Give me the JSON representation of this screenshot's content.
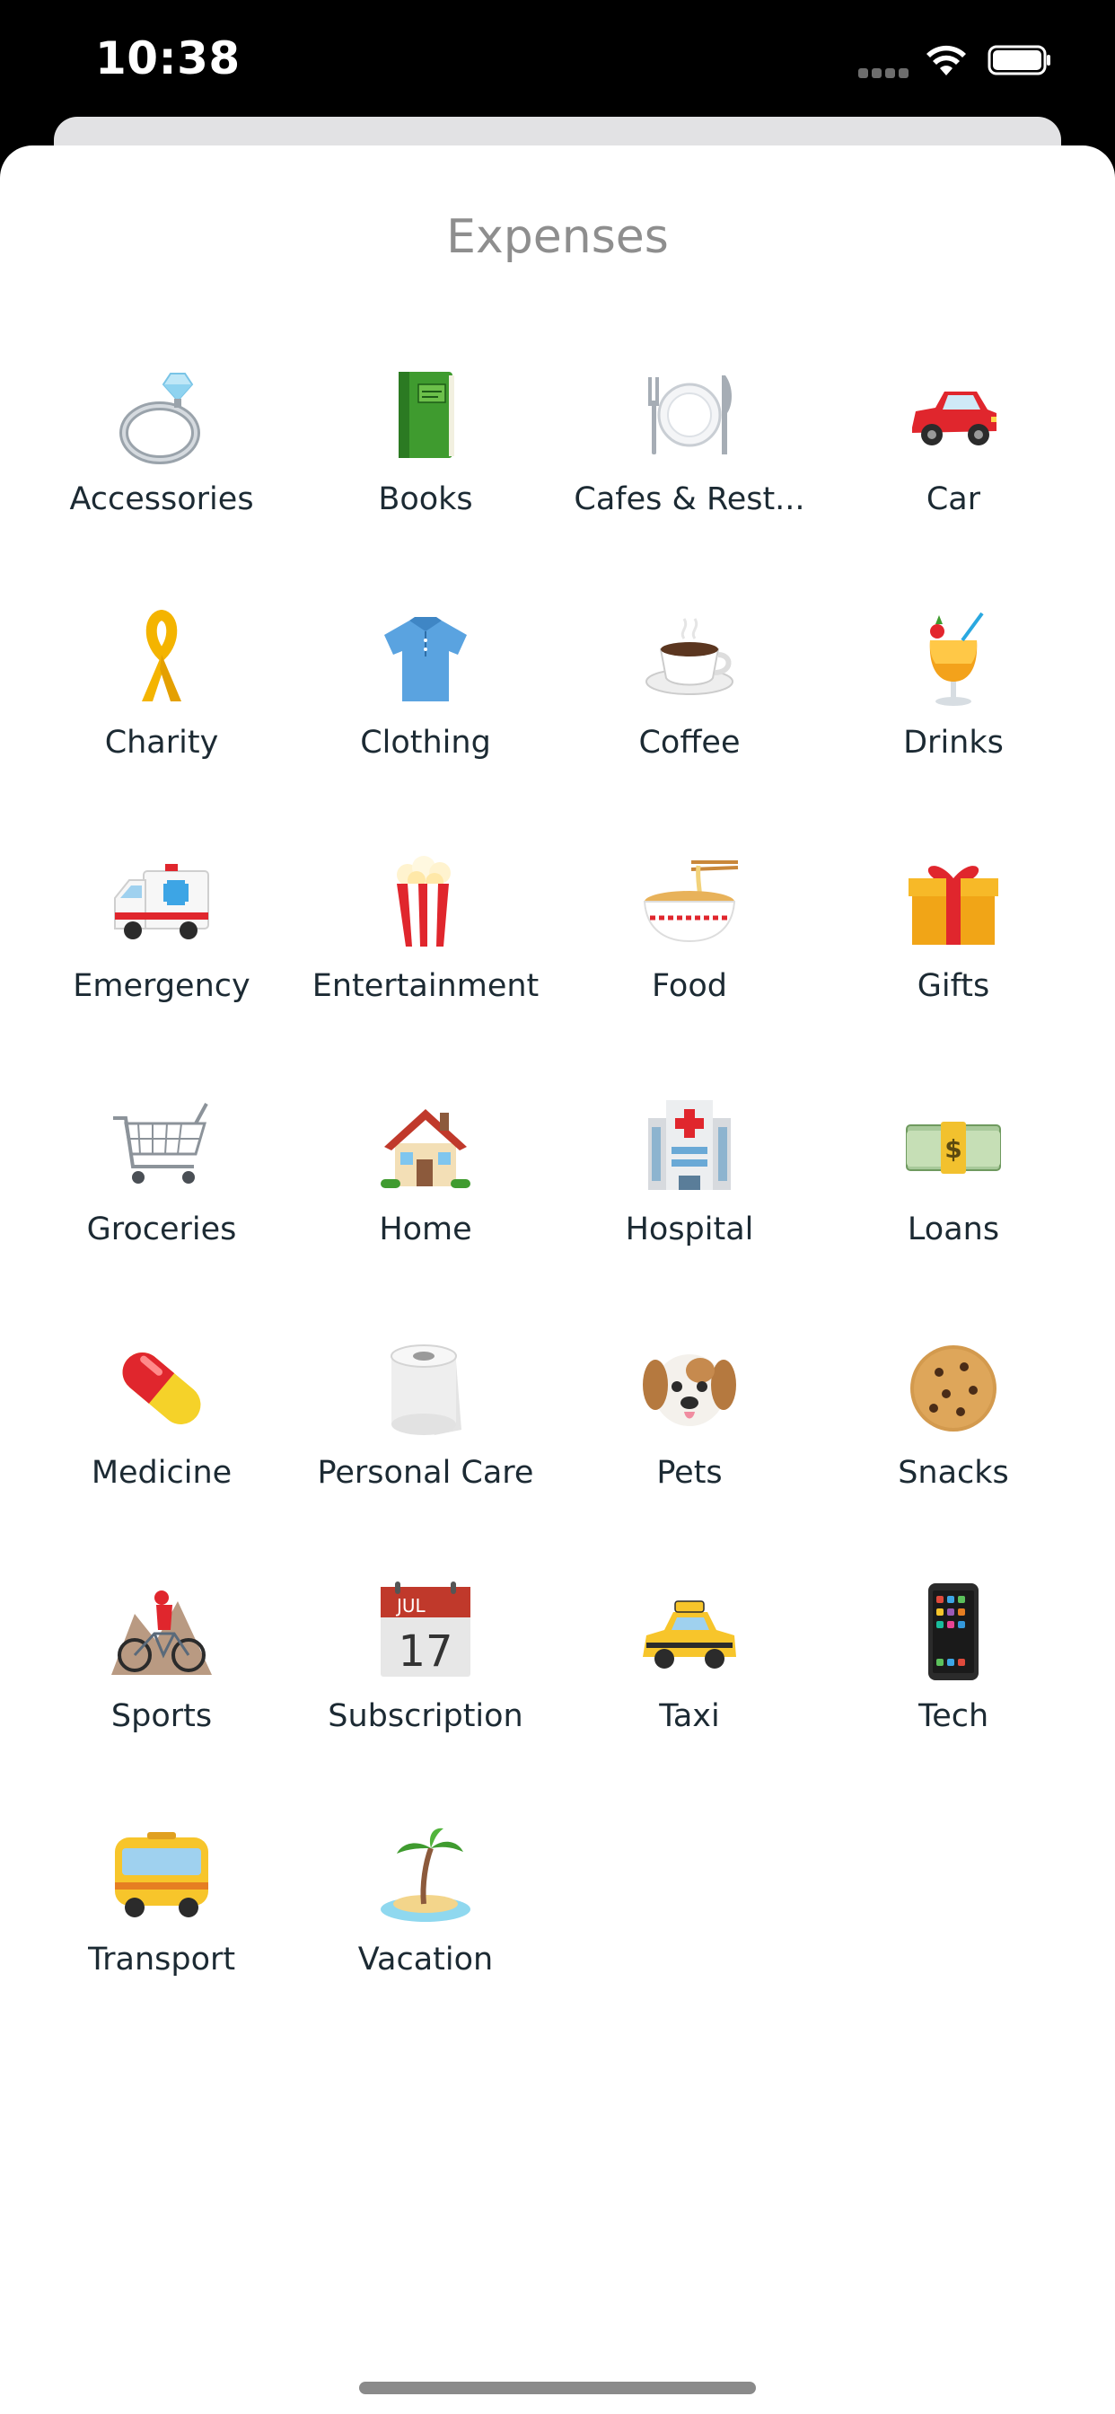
{
  "status_bar": {
    "time": "10:38"
  },
  "sheet": {
    "title": "Expenses"
  },
  "categories": [
    {
      "label": "Accessories",
      "icon": "ring-icon"
    },
    {
      "label": "Books",
      "icon": "book-icon"
    },
    {
      "label": "Cafes & Rest...",
      "icon": "plate-cutlery-icon"
    },
    {
      "label": "Car",
      "icon": "car-icon"
    },
    {
      "label": "Charity",
      "icon": "ribbon-icon"
    },
    {
      "label": "Clothing",
      "icon": "shirt-icon"
    },
    {
      "label": "Coffee",
      "icon": "coffee-cup-icon"
    },
    {
      "label": "Drinks",
      "icon": "cocktail-icon"
    },
    {
      "label": "Emergency",
      "icon": "ambulance-icon"
    },
    {
      "label": "Entertainment",
      "icon": "popcorn-icon"
    },
    {
      "label": "Food",
      "icon": "noodle-bowl-icon"
    },
    {
      "label": "Gifts",
      "icon": "gift-icon"
    },
    {
      "label": "Groceries",
      "icon": "shopping-cart-icon"
    },
    {
      "label": "Home",
      "icon": "house-icon"
    },
    {
      "label": "Hospital",
      "icon": "hospital-icon"
    },
    {
      "label": "Loans",
      "icon": "money-stack-icon"
    },
    {
      "label": "Medicine",
      "icon": "pill-icon"
    },
    {
      "label": "Personal Care",
      "icon": "toilet-roll-icon"
    },
    {
      "label": "Pets",
      "icon": "dog-face-icon"
    },
    {
      "label": "Snacks",
      "icon": "cookie-icon"
    },
    {
      "label": "Sports",
      "icon": "mountain-bike-icon"
    },
    {
      "label": "Subscription",
      "icon": "calendar-icon"
    },
    {
      "label": "Taxi",
      "icon": "taxi-icon"
    },
    {
      "label": "Tech",
      "icon": "smartphone-icon"
    },
    {
      "label": "Transport",
      "icon": "bus-icon"
    },
    {
      "label": "Vacation",
      "icon": "island-icon"
    }
  ],
  "calendar_icon": {
    "month": "JUL",
    "day": "17"
  },
  "colors": {
    "title": "#8e8e8e",
    "label": "#1c2a33",
    "sheet_background": "#ffffff",
    "status_background": "#000000"
  }
}
